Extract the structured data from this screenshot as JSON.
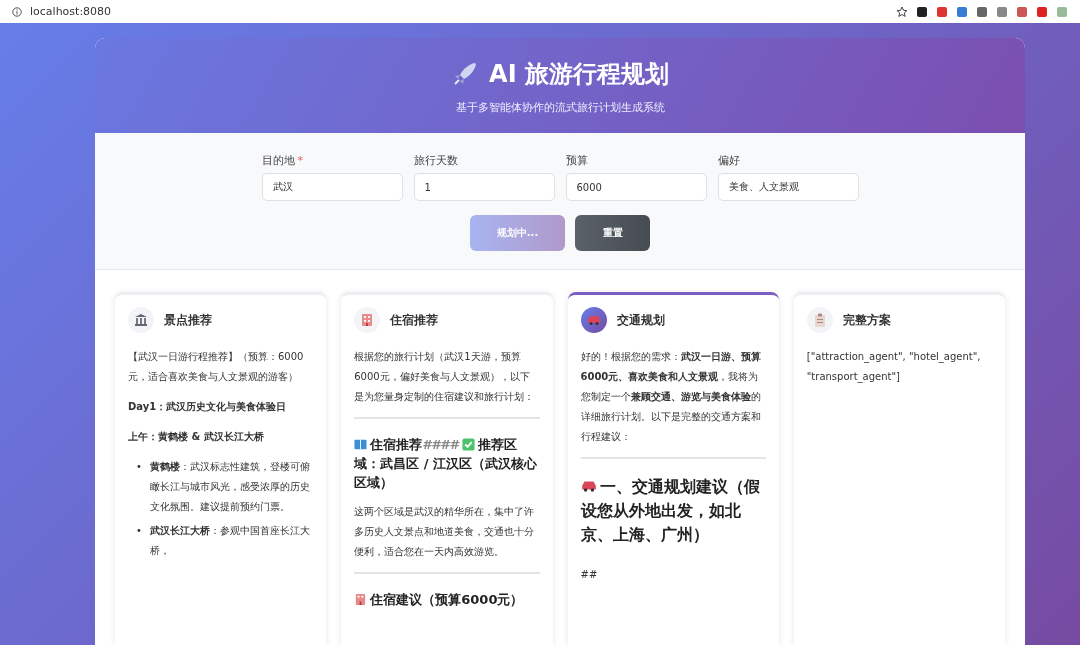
{
  "browser": {
    "url": "localhost:8080"
  },
  "header": {
    "title": "AI 旅游行程规划",
    "subtitle": "基于多智能体协作的流式旅行计划生成系统"
  },
  "form": {
    "fields": [
      {
        "label": "目的地",
        "required_mark": "*",
        "value": "武汉"
      },
      {
        "label": "旅行天数",
        "value": "1"
      },
      {
        "label": "预算",
        "value": "6000"
      },
      {
        "label": "偏好",
        "value": "美食、人文景观"
      }
    ],
    "buttons": [
      {
        "kind": "primary",
        "label": "规划中...",
        "disabled": true
      },
      {
        "kind": "secondary",
        "label": "重置",
        "disabled": false
      }
    ]
  },
  "cards": [
    {
      "kind": "attraction",
      "title": "景点推荐",
      "active": false,
      "blocks": [
        {
          "kind": "p",
          "text": "【武汉一日游行程推荐】（预算：6000元，适合喜欢美食与人文景观的游客）"
        },
        {
          "kind": "p",
          "text": "**Day1：武汉历史文化与美食体验日**"
        },
        {
          "kind": "p",
          "text": "**上午：黄鹤楼 & 武汉长江大桥**"
        },
        {
          "kind": "list",
          "items": [
            {
              "marker": "•",
              "text": "**黄鹤楼**：武汉标志性建筑，登楼可俯瞰长江与城市风光，感受浓厚的历史文化氛围。建议提前预约门票。"
            },
            {
              "marker": "•",
              "text": "**武汉长江大桥**：参观中国首座长江大桥，"
            }
          ]
        }
      ]
    },
    {
      "kind": "hotel",
      "title": "住宿推荐",
      "active": false,
      "blocks": [
        {
          "kind": "p",
          "text": "根据您的旅行计划（武汉1天游，预算6000元，偏好美食与人文景观），以下是为您量身定制的住宿建议和旅行计划："
        },
        {
          "kind": "rule"
        },
        {
          "kind": "heading",
          "parts": [
            {
              "kind": "book-icon"
            },
            {
              "kind": "text",
              "text": "住宿推荐"
            },
            {
              "kind": "faint",
              "text": "####"
            },
            {
              "kind": "check-icon"
            },
            {
              "kind": "text",
              "text": "推荐区域：武昌区 / 江汉区（武汉核心区域）"
            }
          ]
        },
        {
          "kind": "p",
          "text": "这两个区域是武汉的精华所在，集中了许多历史人文景点和地道美食，交通也十分便利，适合您在一天内高效游览。"
        },
        {
          "kind": "rule"
        },
        {
          "kind": "heading",
          "parts": [
            {
              "kind": "hotel-icon"
            },
            {
              "kind": "text",
              "text": "住宿建议（预算6000元）"
            }
          ]
        }
      ]
    },
    {
      "kind": "transport",
      "title": "交通规划",
      "active": true,
      "blocks": [
        {
          "kind": "p",
          "text": "好的！根据您的需求：**武汉一日游、预算6000元、喜欢美食和人文景观**，我将为您制定一个**兼顾交通、游览与美食体验**的详细旅行计划。以下是完整的交通方案和行程建议："
        },
        {
          "kind": "rule"
        },
        {
          "kind": "bigheading",
          "parts": [
            {
              "kind": "car-icon"
            },
            {
              "kind": "text",
              "text": "一、交通规划建议（假设您从外地出发，如北京、上海、广州）"
            }
          ]
        },
        {
          "kind": "p",
          "text": "##"
        }
      ]
    },
    {
      "kind": "summary",
      "title": "完整方案",
      "active": false,
      "blocks": [
        {
          "kind": "p",
          "text": "[\"attraction_agent\", \"hotel_agent\", \"transport_agent\"]"
        }
      ]
    }
  ]
}
